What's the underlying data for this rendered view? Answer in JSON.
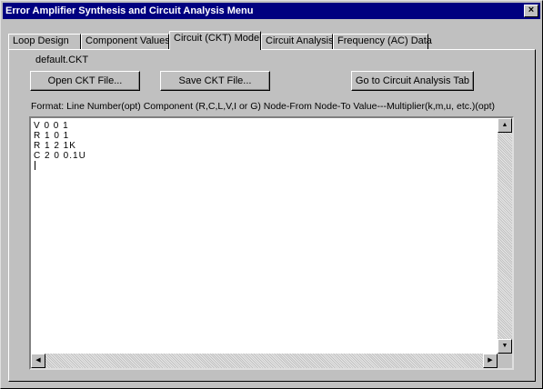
{
  "window": {
    "title": "Error Amplifier Synthesis and Circuit Analysis Menu",
    "close_label": "×"
  },
  "tabs": [
    {
      "label": "Loop Design",
      "active": false
    },
    {
      "label": "Component Values",
      "active": false
    },
    {
      "label": "Circuit (CKT) Model",
      "active": true
    },
    {
      "label": "Circuit Analysis",
      "active": false
    },
    {
      "label": "Frequency (AC) Data",
      "active": false
    }
  ],
  "panel": {
    "filename": "default.CKT",
    "open_button": "Open CKT File...",
    "save_button": "Save CKT File...",
    "goto_button": "Go to Circuit Analysis Tab",
    "format_label": "Format:  Line Number(opt)  Component (R,C,L,V,I or G)  Node-From  Node-To  Value---Multiplier(k,m,u, etc.)(opt)",
    "editor_text": "V 0 0 1\nR 1 0 1\nR 1 2 1K\nC 2 0 0.1U"
  },
  "scrollbar_icons": {
    "up": "up-arrow-icon",
    "down": "down-arrow-icon",
    "left": "left-arrow-icon",
    "right": "right-arrow-icon"
  }
}
